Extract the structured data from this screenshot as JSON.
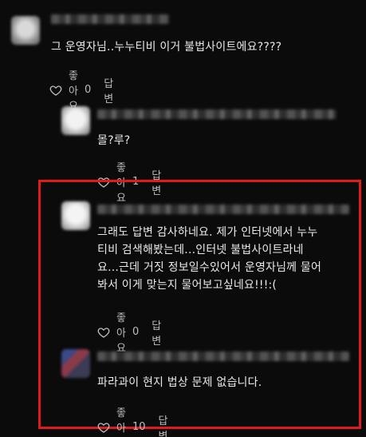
{
  "comments": [
    {
      "text": "그 운영자님..누누티비 이거 불법사이트에요????",
      "like_label": "좋아요",
      "like_count": "0",
      "reply_label": "답변"
    },
    {
      "text": "몰?루?",
      "like_label": "좋아요",
      "like_count": "1",
      "reply_label": "답변"
    },
    {
      "text": "그래도 답변 감사하네요. 제가 인터넷에서 누누\n티비 검색해봤는데...인터넷 불법사이트라네\n요...근데 거짓 정보일수있어서 운영자님께 물어\n봐서 이게 맞는지 물어보고싶네요!!!:(",
      "like_label": "좋아요",
      "like_count": "0",
      "reply_label": "답변"
    },
    {
      "text": "파라과이 현지 법상 문제 없습니다.",
      "like_label": "좋아요",
      "like_count": "10",
      "reply_label": "답변"
    }
  ],
  "highlight_color": "#e11b1b",
  "icons": {
    "like": "heart-outline-icon"
  }
}
